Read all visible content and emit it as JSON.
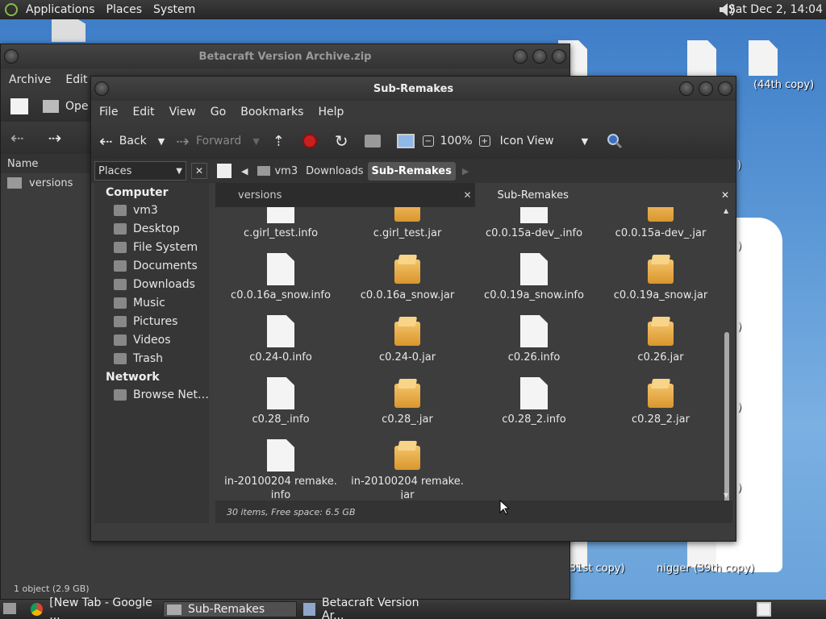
{
  "top_panel": {
    "applications": "Applications",
    "places": "Places",
    "system": "System",
    "clock": "Sat Dec  2, 14:04"
  },
  "desktop": {
    "labels": [
      "(44th copy)",
      "31st copy)",
      "nigger (39th copy)",
      ")",
      ")",
      ")",
      ")",
      ")",
      ")",
      ")",
      ")",
      ")"
    ]
  },
  "archive_window": {
    "title": "Betacraft Version Archive.zip",
    "menu": [
      "Archive",
      "Edit"
    ],
    "open_label": "Ope",
    "column_name": "Name",
    "entries": [
      "versions"
    ],
    "status": "1 object (2.9 GB)"
  },
  "fm_window": {
    "title": "Sub-Remakes",
    "menu": [
      "File",
      "Edit",
      "View",
      "Go",
      "Bookmarks",
      "Help"
    ],
    "toolbar": {
      "back": "Back",
      "forward": "Forward",
      "zoom": "100%",
      "view": "Icon View"
    },
    "places_label": "Places",
    "path": [
      "vm3",
      "Downloads",
      "Sub-Remakes"
    ],
    "sidebar": {
      "computer_header": "Computer",
      "computer_items": [
        "vm3",
        "Desktop",
        "File System",
        "Documents",
        "Downloads",
        "Music",
        "Pictures",
        "Videos",
        "Trash"
      ],
      "network_header": "Network",
      "network_items": [
        "Browse Net…"
      ]
    },
    "tabs": [
      "versions",
      "Sub-Remakes"
    ],
    "files": [
      {
        "name": "c.girl_test.info",
        "type": "doc"
      },
      {
        "name": "c.girl_test.jar",
        "type": "jar"
      },
      {
        "name": "c0.0.15a-dev_.info",
        "type": "doc"
      },
      {
        "name": "c0.0.15a-dev_.jar",
        "type": "jar"
      },
      {
        "name": "c0.0.16a_snow.info",
        "type": "doc"
      },
      {
        "name": "c0.0.16a_snow.jar",
        "type": "jar"
      },
      {
        "name": "c0.0.19a_snow.info",
        "type": "doc"
      },
      {
        "name": "c0.0.19a_snow.jar",
        "type": "jar"
      },
      {
        "name": "c0.24-0.info",
        "type": "doc"
      },
      {
        "name": "c0.24-0.jar",
        "type": "jar"
      },
      {
        "name": "c0.26.info",
        "type": "doc"
      },
      {
        "name": "c0.26.jar",
        "type": "jar"
      },
      {
        "name": "c0.28_.info",
        "type": "doc"
      },
      {
        "name": "c0.28_.jar",
        "type": "jar"
      },
      {
        "name": "c0.28_2.info",
        "type": "doc"
      },
      {
        "name": "c0.28_2.jar",
        "type": "jar"
      },
      {
        "name": "in-20100204 remake.\ninfo",
        "type": "doc"
      },
      {
        "name": "in-20100204 remake.\njar",
        "type": "jar"
      }
    ],
    "status": "30 items, Free space: 6.5 GB"
  },
  "taskbar": {
    "items": [
      "[New Tab - Google ...",
      "Sub-Remakes",
      "Betacraft Version Ar..."
    ]
  },
  "colors": {
    "accent": "#505050",
    "jar": "#e9ac45"
  }
}
